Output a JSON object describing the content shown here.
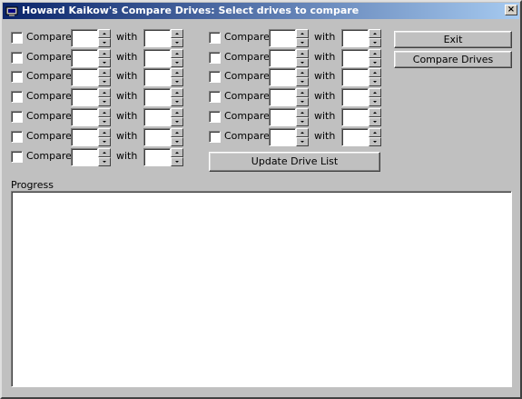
{
  "window": {
    "title": "Howard Kaikow's Compare Drives: Select drives to compare",
    "close_glyph": "×"
  },
  "compare_rows": {
    "left": [
      {
        "label": "Compare",
        "with_label": "with",
        "drive_a": "",
        "drive_b": "",
        "checked": false
      },
      {
        "label": "Compare",
        "with_label": "with",
        "drive_a": "",
        "drive_b": "",
        "checked": false
      },
      {
        "label": "Compare",
        "with_label": "with",
        "drive_a": "",
        "drive_b": "",
        "checked": false
      },
      {
        "label": "Compare",
        "with_label": "with",
        "drive_a": "",
        "drive_b": "",
        "checked": false
      },
      {
        "label": "Compare",
        "with_label": "with",
        "drive_a": "",
        "drive_b": "",
        "checked": false
      },
      {
        "label": "Compare",
        "with_label": "with",
        "drive_a": "",
        "drive_b": "",
        "checked": false
      },
      {
        "label": "Compare",
        "with_label": "with",
        "drive_a": "",
        "drive_b": "",
        "checked": false
      }
    ],
    "right": [
      {
        "label": "Compare",
        "with_label": "with",
        "drive_a": "",
        "drive_b": "",
        "checked": false
      },
      {
        "label": "Compare",
        "with_label": "with",
        "drive_a": "",
        "drive_b": "",
        "checked": false
      },
      {
        "label": "Compare",
        "with_label": "with",
        "drive_a": "",
        "drive_b": "",
        "checked": false
      },
      {
        "label": "Compare",
        "with_label": "with",
        "drive_a": "",
        "drive_b": "",
        "checked": false
      },
      {
        "label": "Compare",
        "with_label": "with",
        "drive_a": "",
        "drive_b": "",
        "checked": false
      },
      {
        "label": "Compare",
        "with_label": "with",
        "drive_a": "",
        "drive_b": "",
        "checked": false
      }
    ]
  },
  "buttons": {
    "exit": "Exit",
    "compare_drives": "Compare Drives",
    "update_drive_list": "Update Drive List"
  },
  "progress": {
    "label": "Progress",
    "text": ""
  }
}
